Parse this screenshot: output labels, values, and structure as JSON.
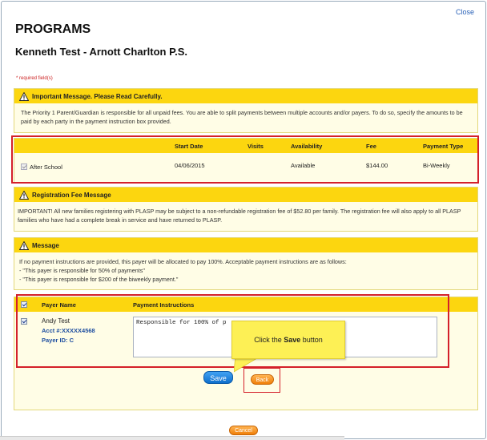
{
  "header": {
    "close_label": "Close",
    "title": "PROGRAMS",
    "subtitle": "Kenneth Test - Arnott Charlton P.S.",
    "required_note": "* required field(s)"
  },
  "important_message": {
    "heading": "Important Message. Please Read Carefully.",
    "body": "The Priority 1 Parent/Guardian is responsible for all unpaid fees. You are able to split payments between multiple accounts and/or payers. To do so, specify the amounts to be paid by each party in the payment instruction box provided."
  },
  "program_table": {
    "columns": [
      "Start Date",
      "Visits",
      "Availability",
      "Fee",
      "Payment Type"
    ],
    "rows": [
      {
        "program": "After School",
        "checked": true,
        "start_date": "04/06/2015",
        "visits": "",
        "availability": "Available",
        "fee": "$144.00",
        "payment_type": "Bi-Weekly"
      }
    ]
  },
  "registration_fee": {
    "heading": "Registration Fee Message",
    "body": "IMPORTANT! All new families registering with PLASP may be subject to a non-refundable registration fee of $52.80 per family. The registration fee will also apply to all PLASP families who have had a complete break in service and have returned to PLASP."
  },
  "message": {
    "heading": "Message",
    "line1": "If no payment instructions are provided, this payer will be allocated to pay 100%. Acceptable payment instructions are as follows:",
    "line2": "- \"This payer is responsible for 50% of payments\"",
    "line3": "- \"This payer is responsible for $200 of the biweekly payment.\""
  },
  "payer_table": {
    "col_payer": "Payer Name",
    "col_instructions": "Payment Instructions",
    "payer": {
      "name": "Andy Test",
      "acct": "Acct #:XXXXX4568",
      "payer_id": "Payer ID: C",
      "instructions": "Responsible for 100% of p"
    }
  },
  "callout": {
    "prefix": "Click the ",
    "bold": "Save",
    "suffix": " button"
  },
  "buttons": {
    "save": "Save",
    "back": "Back",
    "cancel": "Cancel"
  },
  "colors": {
    "header_yellow": "#fcd60f",
    "panel_bg": "#fffde6",
    "highlight_red": "#d4202a",
    "save_blue": "#1f86e0",
    "orange": "#f5900f",
    "link_blue": "#2a62b8"
  }
}
